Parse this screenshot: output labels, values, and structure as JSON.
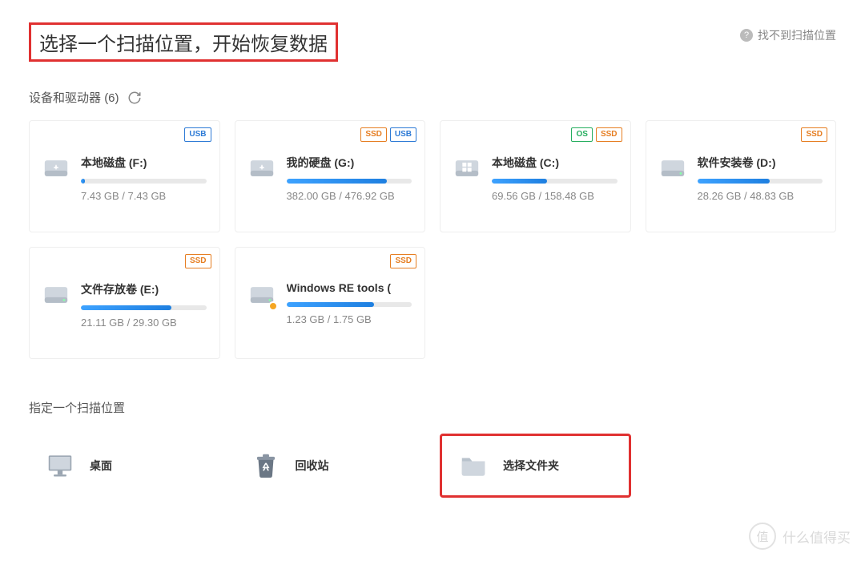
{
  "header": {
    "title": "选择一个扫描位置，开始恢复数据",
    "help_label": "找不到扫描位置"
  },
  "devices_section": {
    "title_prefix": "设备和驱动器",
    "count": "(6)"
  },
  "drives": [
    {
      "name": "本地磁盘 (F:)",
      "size": "7.43 GB / 7.43 GB",
      "fill_pct": 3,
      "badges": [
        "USB"
      ],
      "icon": "usb",
      "warn": false
    },
    {
      "name": "我的硬盘 (G:)",
      "size": "382.00 GB / 476.92 GB",
      "fill_pct": 80,
      "badges": [
        "SSD",
        "USB"
      ],
      "icon": "usb",
      "warn": false
    },
    {
      "name": "本地磁盘 (C:)",
      "size": "69.56 GB / 158.48 GB",
      "fill_pct": 44,
      "badges": [
        "OS",
        "SSD"
      ],
      "icon": "windows",
      "warn": false
    },
    {
      "name": "软件安装卷 (D:)",
      "size": "28.26 GB / 48.83 GB",
      "fill_pct": 58,
      "badges": [
        "SSD"
      ],
      "icon": "hdd",
      "warn": false
    },
    {
      "name": "文件存放卷 (E:)",
      "size": "21.11 GB / 29.30 GB",
      "fill_pct": 72,
      "badges": [
        "SSD"
      ],
      "icon": "hdd",
      "warn": false
    },
    {
      "name": "Windows RE tools (",
      "size": "1.23 GB / 1.75 GB",
      "fill_pct": 70,
      "badges": [
        "SSD"
      ],
      "icon": "hdd",
      "warn": true
    }
  ],
  "targets_section": {
    "title": "指定一个扫描位置"
  },
  "targets": [
    {
      "label": "桌面",
      "icon": "desktop",
      "highlight": false
    },
    {
      "label": "回收站",
      "icon": "recycle",
      "highlight": false
    },
    {
      "label": "选择文件夹",
      "icon": "folder",
      "highlight": true
    }
  ],
  "badge_labels": {
    "USB": "USB",
    "SSD": "SSD",
    "OS": "OS"
  },
  "watermark": {
    "char": "值",
    "text": "什么值得买"
  }
}
